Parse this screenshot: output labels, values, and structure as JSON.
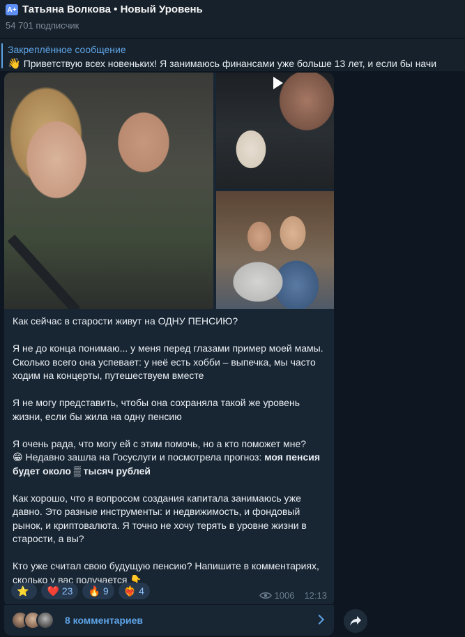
{
  "header": {
    "channel_title": "Татьяна Волкова • Новый Уровень",
    "subscribers": "54 701 подписчик",
    "icon_glyph": "A+"
  },
  "pinned": {
    "title": "Закреплённое сообщение",
    "text": "Приветствую всех новеньких!  Я занимаюсь финансами уже больше 13 лет, и если бы начи",
    "emoji": "👋"
  },
  "message": {
    "p1": "Как сейчас в старости живут на ОДНУ ПЕНСИЮ?",
    "p2": "Я не до конца понимаю... у меня перед глазами пример моей мамы. Сколько всего она успевает: у неё есть хобби – выпечка, мы часто ходим на концерты, путешествуем вместе",
    "p3": "Я не могу представить, чтобы она сохраняла такой же уровень жизни, если бы жила на одну пенсию",
    "p4_a": "Я очень рада, что могу ей с этим помочь, но а кто поможет мне?",
    "p4_emoji": "😁",
    "p4_b": " Недавно зашла на Госуслуги и посмотрела прогноз: ",
    "p4_bold_a": "моя пенсия будет около ",
    "p4_hidden": "▒",
    "p4_bold_b": " тысяч рублей",
    "p5": "Как хорошо, что я вопросом создания капитала занимаюсь уже давно. Это разные инструменты: и недвижимость, и фондовый рынок, и криптовалюта. Я точно не хочу терять в уровне жизни в старости, а вы?",
    "p6": "Кто уже считал свою будущую пенсию? Напишите в комментариях, сколько у вас получается ",
    "p6_emoji": "👇"
  },
  "reactions": [
    {
      "emoji": "⭐",
      "count": ""
    },
    {
      "emoji": "❤️",
      "count": "23"
    },
    {
      "emoji": "🔥",
      "count": "9"
    },
    {
      "emoji": "❤️‍🔥",
      "count": "4"
    }
  ],
  "meta": {
    "views": "1006",
    "time": "12:13"
  },
  "comments": {
    "label": "8 комментариев"
  },
  "colors": {
    "background": "#0e1621",
    "bubble": "#182533",
    "accent": "#5ea4e6"
  }
}
